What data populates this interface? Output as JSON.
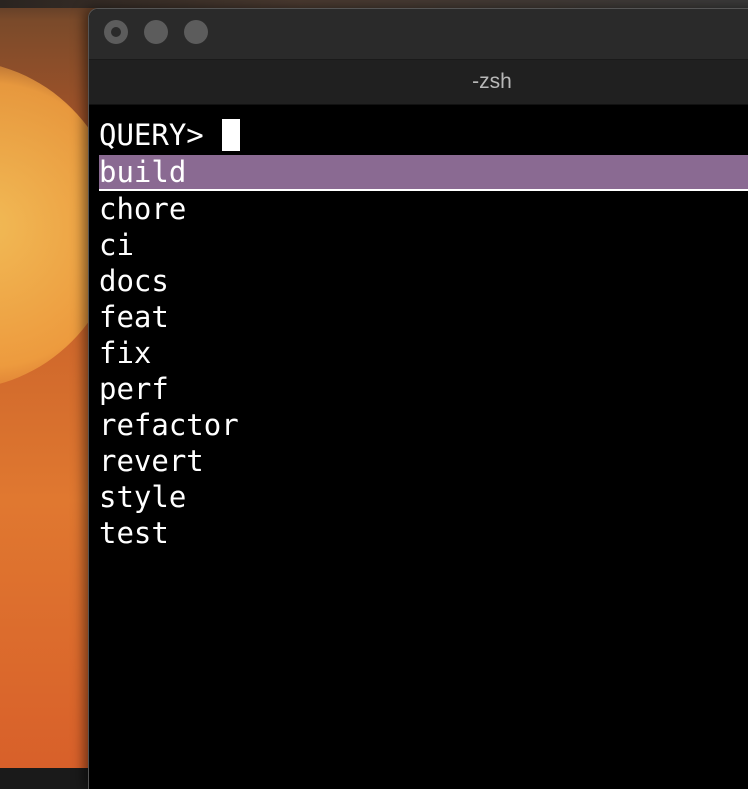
{
  "window": {
    "title": "-zsh"
  },
  "terminal": {
    "prompt": "QUERY>",
    "query_value": "",
    "selected_index": 0,
    "results": [
      "build",
      "chore",
      "ci",
      "docs",
      "feat",
      "fix",
      "perf",
      "refactor",
      "revert",
      "style",
      "test"
    ]
  },
  "colors": {
    "selection_background": "#8a6a92",
    "terminal_background": "#000000",
    "terminal_foreground": "#ffffff"
  }
}
